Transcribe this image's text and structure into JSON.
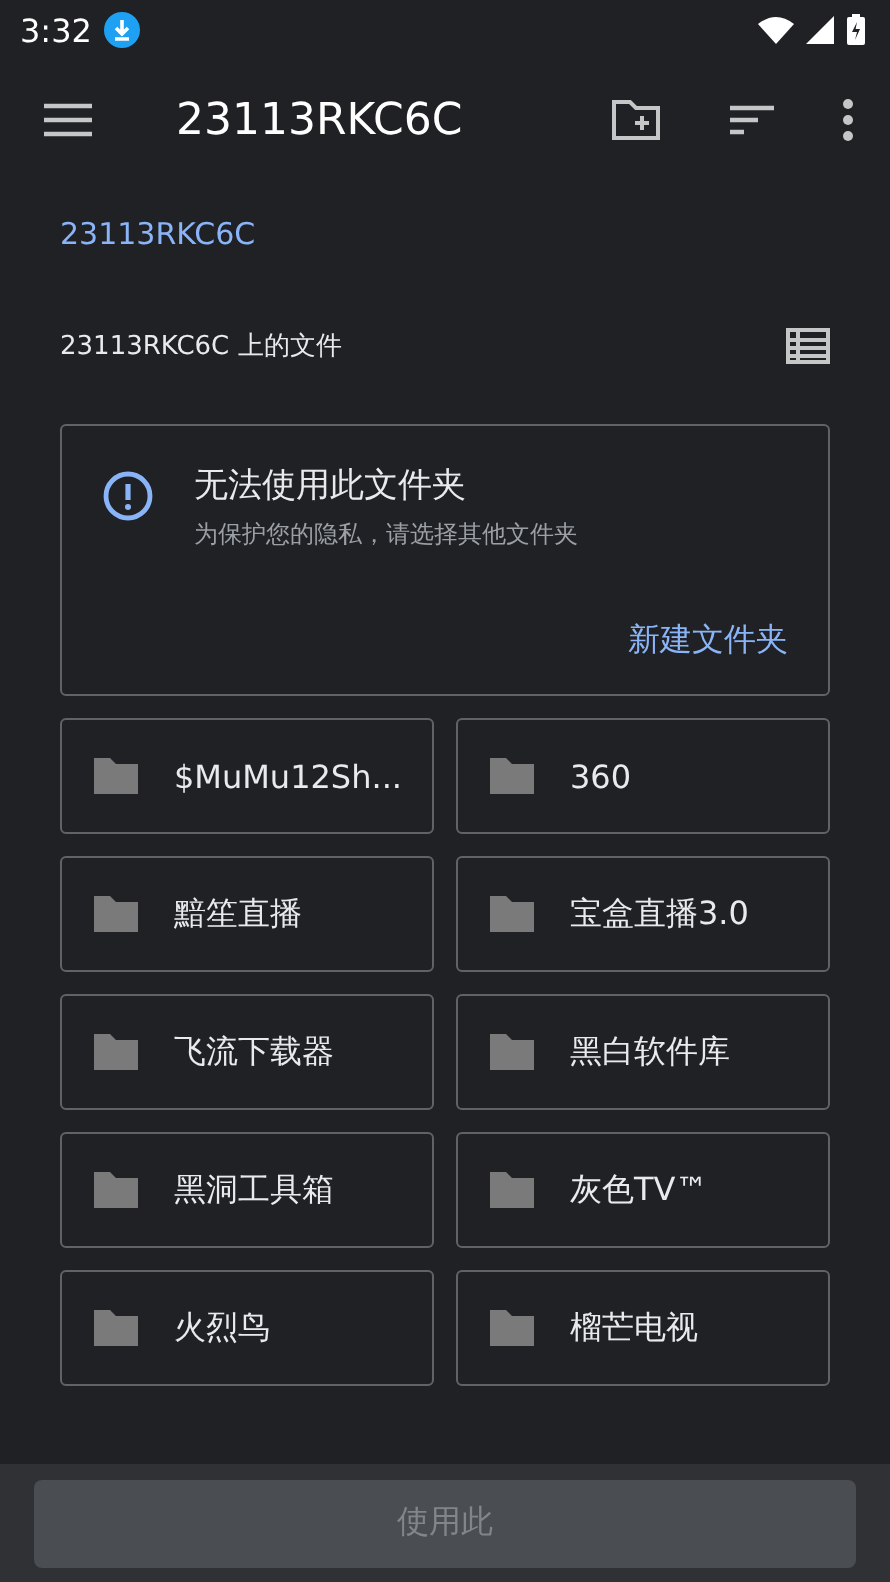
{
  "status_bar": {
    "time": "3:32"
  },
  "app_bar": {
    "title": "23113RKC6C"
  },
  "breadcrumb": "23113RKC6C",
  "section_title": "23113RKC6C 上的文件",
  "notice": {
    "title": "无法使用此文件夹",
    "message": "为保护您的隐私，请选择其他文件夹",
    "action": "新建文件夹"
  },
  "folders": [
    {
      "name": "$MuMu12Sh..."
    },
    {
      "name": "360"
    },
    {
      "name": "黯笙直播"
    },
    {
      "name": "宝盒直播3.0"
    },
    {
      "name": "飞流下载器"
    },
    {
      "name": "黑白软件库"
    },
    {
      "name": "黑洞工具箱"
    },
    {
      "name": "灰色TV™"
    },
    {
      "name": "火烈鸟"
    },
    {
      "name": "榴芒电视"
    }
  ],
  "bottom_button": {
    "label": "使用此",
    "disabled": true
  }
}
